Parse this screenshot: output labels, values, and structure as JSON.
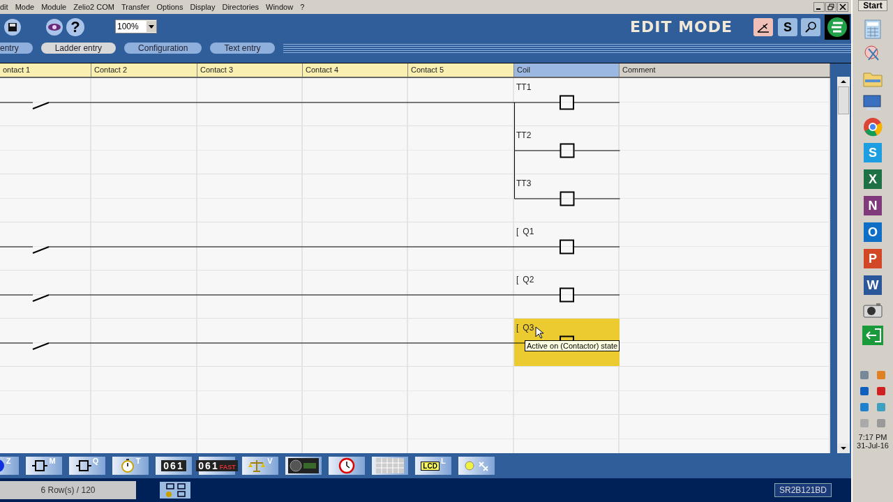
{
  "menu": [
    "dit",
    "Mode",
    "Module",
    "Zelio2 COM",
    "Transfer",
    "Options",
    "Display",
    "Directories",
    "Window",
    "?"
  ],
  "toolbar": {
    "zoom": "100%",
    "help": "?",
    "mode_label": "EDIT MODE",
    "s_button": "S"
  },
  "tabs": [
    {
      "label": "entry",
      "selected": false
    },
    {
      "label": "Ladder entry",
      "selected": true
    },
    {
      "label": "Configuration",
      "selected": false
    },
    {
      "label": "Text entry",
      "selected": false
    }
  ],
  "columns": [
    {
      "label": "ontact 1",
      "kind": "contact"
    },
    {
      "label": "Contact 2",
      "kind": "contact"
    },
    {
      "label": "Contact 3",
      "kind": "contact"
    },
    {
      "label": "Contact 4",
      "kind": "contact"
    },
    {
      "label": "Contact 5",
      "kind": "contact"
    },
    {
      "label": "Coil",
      "kind": "coil"
    },
    {
      "label": "Comment",
      "kind": "comment"
    }
  ],
  "rungs": [
    {
      "coil": "TT1",
      "kind": "contact",
      "selected": false
    },
    {
      "coil": "TT2",
      "kind": "branch",
      "selected": false
    },
    {
      "coil": "TT3",
      "kind": "branch",
      "selected": false
    },
    {
      "coil": "Q1",
      "prefix": "[",
      "kind": "contact",
      "selected": false
    },
    {
      "coil": "Q2",
      "prefix": "[",
      "kind": "contact",
      "selected": false
    },
    {
      "coil": "Q3",
      "prefix": "[",
      "kind": "contact",
      "selected": true
    }
  ],
  "tooltip": "Active on (Contactor) state",
  "function_keys": [
    {
      "kind": "disc",
      "letter": "Z"
    },
    {
      "kind": "box",
      "letter": "M"
    },
    {
      "kind": "box",
      "letter": "Q"
    },
    {
      "kind": "timer",
      "letter": "T"
    },
    {
      "kind": "counter",
      "text": "061"
    },
    {
      "kind": "fastcounter",
      "text": "061",
      "sub": "FAST"
    },
    {
      "kind": "scale",
      "letter": "V"
    },
    {
      "kind": "analog"
    },
    {
      "kind": "clock"
    },
    {
      "kind": "grid"
    },
    {
      "kind": "lcd",
      "text": "LCD",
      "letter": "L"
    },
    {
      "kind": "light"
    }
  ],
  "status": {
    "rows": "6 Row(s) / 120",
    "module": "SR2B121BD"
  },
  "taskbar": {
    "start": "Start",
    "apps": [
      {
        "kind": "calc"
      },
      {
        "kind": "snip"
      },
      {
        "kind": "folder"
      },
      {
        "kind": "screen"
      },
      {
        "kind": "chrome"
      },
      {
        "kind": "tile",
        "letter": "S",
        "color": "#1c9ee0"
      },
      {
        "kind": "tile",
        "letter": "X",
        "color": "#1e7145"
      },
      {
        "kind": "tile",
        "letter": "N",
        "color": "#80397b"
      },
      {
        "kind": "tile",
        "letter": "O",
        "color": "#0f6fc6"
      },
      {
        "kind": "tile",
        "letter": "P",
        "color": "#d24726"
      },
      {
        "kind": "tile",
        "letter": "W",
        "color": "#2b579a"
      },
      {
        "kind": "camera"
      },
      {
        "kind": "exit"
      }
    ],
    "time": "7:17 PM",
    "date": "31-Jul-16"
  }
}
